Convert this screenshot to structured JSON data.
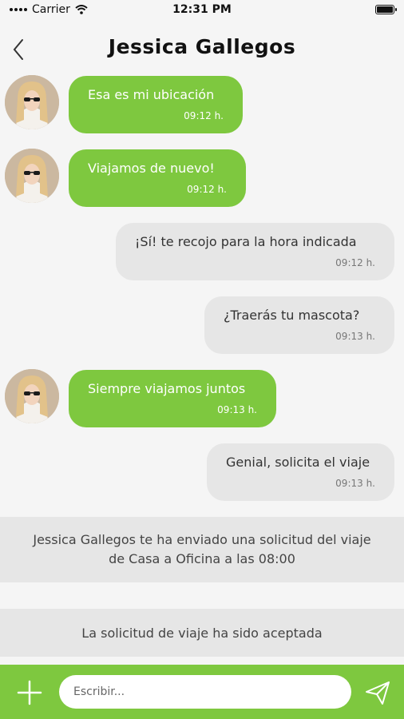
{
  "status": {
    "carrier": "Carrier",
    "time": "12:31 PM"
  },
  "header": {
    "title": "Jessica Gallegos"
  },
  "messages": [
    {
      "text": "Esa es mi ubicación",
      "time": "09:12 h.",
      "direction": "in"
    },
    {
      "text": "Viajamos de nuevo!",
      "time": "09:12 h.",
      "direction": "in"
    },
    {
      "text": "¡Sí! te recojo para la hora indicada",
      "time": "09:12 h.",
      "direction": "out"
    },
    {
      "text": "¿Traerás tu mascota?",
      "time": "09:13 h.",
      "direction": "out"
    },
    {
      "text": "Siempre viajamos juntos",
      "time": "09:13 h.",
      "direction": "in"
    },
    {
      "text": "Genial, solicita el viaje",
      "time": "09:13 h.",
      "direction": "out"
    }
  ],
  "notices": {
    "request_line1": "Jessica Gallegos  te ha enviado una solicitud del viaje",
    "request_line2": "de Casa a Oficina a las 08:00",
    "accepted": "La solicitud de viaje ha sido aceptada"
  },
  "composer": {
    "placeholder": "Escribir..."
  },
  "colors": {
    "accent_green": "#7ec83f",
    "outgoing_bubble": "#e6e6e6",
    "background": "#f5f5f5"
  },
  "icons": {
    "back": "chevron-left-icon",
    "attach": "plus-icon",
    "send": "paper-plane-icon",
    "wifi": "wifi-icon",
    "battery": "battery-icon"
  }
}
